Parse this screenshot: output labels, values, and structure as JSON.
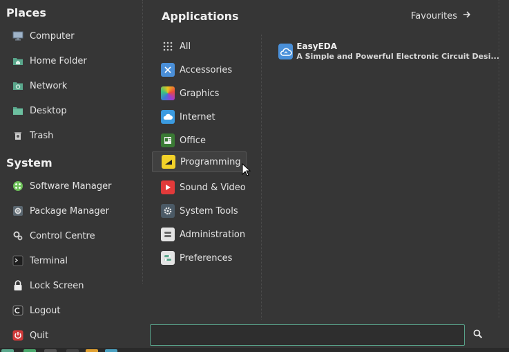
{
  "places": {
    "title": "Places",
    "items": [
      {
        "label": "Computer",
        "icon": "computer-icon"
      },
      {
        "label": "Home Folder",
        "icon": "home-folder-icon"
      },
      {
        "label": "Network",
        "icon": "network-icon"
      },
      {
        "label": "Desktop",
        "icon": "desktop-icon"
      },
      {
        "label": "Trash",
        "icon": "trash-icon"
      }
    ]
  },
  "system": {
    "title": "System",
    "items": [
      {
        "label": "Software Manager",
        "icon": "software-manager-icon"
      },
      {
        "label": "Package Manager",
        "icon": "package-manager-icon"
      },
      {
        "label": "Control Centre",
        "icon": "control-centre-icon"
      },
      {
        "label": "Terminal",
        "icon": "terminal-icon"
      },
      {
        "label": "Lock Screen",
        "icon": "lock-icon"
      },
      {
        "label": "Logout",
        "icon": "logout-icon"
      },
      {
        "label": "Quit",
        "icon": "power-icon"
      }
    ]
  },
  "applications": {
    "title": "Applications",
    "favourites_label": "Favourites",
    "categories": [
      {
        "label": "All",
        "icon": "grid-icon"
      },
      {
        "label": "Accessories",
        "icon": "accessories-icon"
      },
      {
        "label": "Graphics",
        "icon": "graphics-icon"
      },
      {
        "label": "Internet",
        "icon": "cloud-icon"
      },
      {
        "label": "Office",
        "icon": "office-icon"
      },
      {
        "label": "Programming",
        "icon": "programming-icon",
        "selected": true
      },
      {
        "label": "Sound & Video",
        "icon": "play-icon"
      },
      {
        "label": "System Tools",
        "icon": "system-tools-icon"
      },
      {
        "label": "Administration",
        "icon": "administration-icon"
      },
      {
        "label": "Preferences",
        "icon": "preferences-icon"
      }
    ],
    "apps": [
      {
        "name": "EasyEDA",
        "description": "A Simple and Powerful Electronic Circuit Desi...",
        "icon": "easyeda-icon"
      }
    ]
  },
  "search": {
    "value": "",
    "placeholder": ""
  },
  "colors": {
    "background": "#363636",
    "accent": "#58a28a",
    "text": "#e6e6e6"
  }
}
